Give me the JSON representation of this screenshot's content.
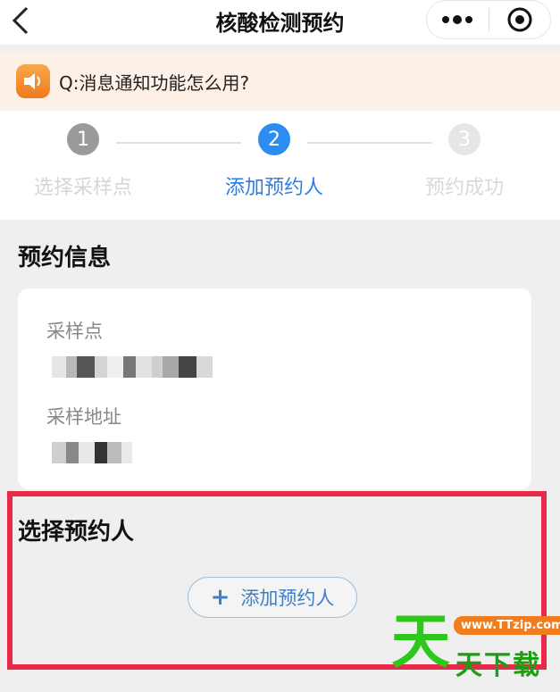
{
  "header": {
    "title": "核酸检测预约",
    "back_icon": "chevron-left-icon",
    "more_icon": "more-dots-icon",
    "close_icon": "target-circle-icon"
  },
  "notice": {
    "icon": "speaker-icon",
    "text": "Q:消息通知功能怎么用?"
  },
  "steps": [
    {
      "num": "1",
      "label": "选择采样点",
      "state": "done"
    },
    {
      "num": "2",
      "label": "添加预约人",
      "state": "active"
    },
    {
      "num": "3",
      "label": "预约成功",
      "state": "pending"
    }
  ],
  "booking_info": {
    "title": "预约信息",
    "sampling_point_label": "采样点",
    "sampling_address_label": "采样地址"
  },
  "choose_person": {
    "title": "选择预约人",
    "add_button_label": "添加预约人",
    "add_icon": "plus-icon"
  },
  "watermark": {
    "big": "天",
    "url": "www.TTzip.com",
    "small": "天下载"
  },
  "colors": {
    "accent": "#2c8cf0",
    "highlight": "#e8294a",
    "watermark_green": "#2ec81d"
  }
}
